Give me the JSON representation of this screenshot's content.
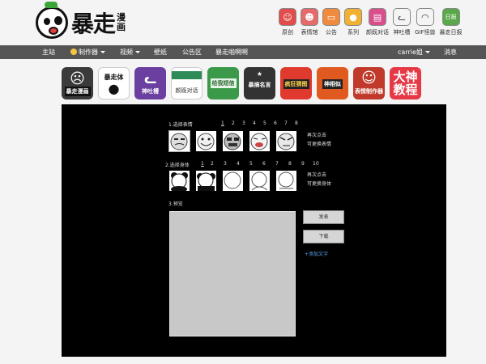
{
  "brand": {
    "name": "暴走",
    "sub": "漫画"
  },
  "topnav": [
    {
      "label": "原创",
      "icon": "original-icon",
      "color": "#e14d4d"
    },
    {
      "label": "表情馆",
      "icon": "emoticon-icon",
      "color": "#e66a6a"
    },
    {
      "label": "公告",
      "icon": "notice-icon",
      "color": "#f08a3e"
    },
    {
      "label": "系列",
      "icon": "series-icon",
      "color": "#f2b133"
    },
    {
      "label": "颜既对话",
      "icon": "dialog-icon",
      "color": "#d94f8c"
    },
    {
      "label": "神吐槽",
      "icon": "cat-icon",
      "color": "#f4f4f4"
    },
    {
      "label": "GIF怪兽",
      "icon": "gif-monster-icon",
      "color": "#f4f4f4"
    },
    {
      "label": "暴走日报",
      "icon": "daily-icon",
      "color": "#59a84a"
    }
  ],
  "navbar": {
    "home": "主站",
    "maker": "制作器",
    "video": "视频",
    "wallpaper": "壁纸",
    "announce": "公告区",
    "tvshow": "暴走啪啊啊",
    "user": "carrie姐",
    "messages": "消息"
  },
  "apps": [
    {
      "label": "暴走漫画",
      "bg": "#3a3a3a"
    },
    {
      "label": "暴走体",
      "big": "暴走体",
      "bg": "#ffffff"
    },
    {
      "label": "神吐槽",
      "bg": "#6b3fa0"
    },
    {
      "label": "颜既对话",
      "bg": "#2e8b57"
    },
    {
      "label": "给我短信",
      "bg": "#3b9a4a"
    },
    {
      "label": "暴搞名言",
      "bg": "#333333"
    },
    {
      "label": "疯狂猜图",
      "bg": "#e03a2f"
    },
    {
      "label": "神相似",
      "bg": "#e05a1f"
    },
    {
      "label": "表情制作器",
      "bg": "#c0392b"
    },
    {
      "label": "大神教程",
      "big": "大神教程",
      "bg": "#e63946"
    }
  ],
  "maker": {
    "step1": "1.选择表情",
    "step2": "2.选择身体",
    "step3": "3.预览",
    "face_pages": [
      "1",
      "2",
      "3",
      "4",
      "5",
      "6",
      "7",
      "8"
    ],
    "body_pages": [
      "1",
      "2",
      "3",
      "4",
      "5",
      "6",
      "7",
      "8",
      "9",
      "10"
    ],
    "hint_face": [
      "再次点击",
      "可更换表情"
    ],
    "hint_body": [
      "再次点击",
      "可更换身体"
    ],
    "btn_publish": "发表",
    "btn_download": "下载",
    "add_text": "+添加文字"
  }
}
